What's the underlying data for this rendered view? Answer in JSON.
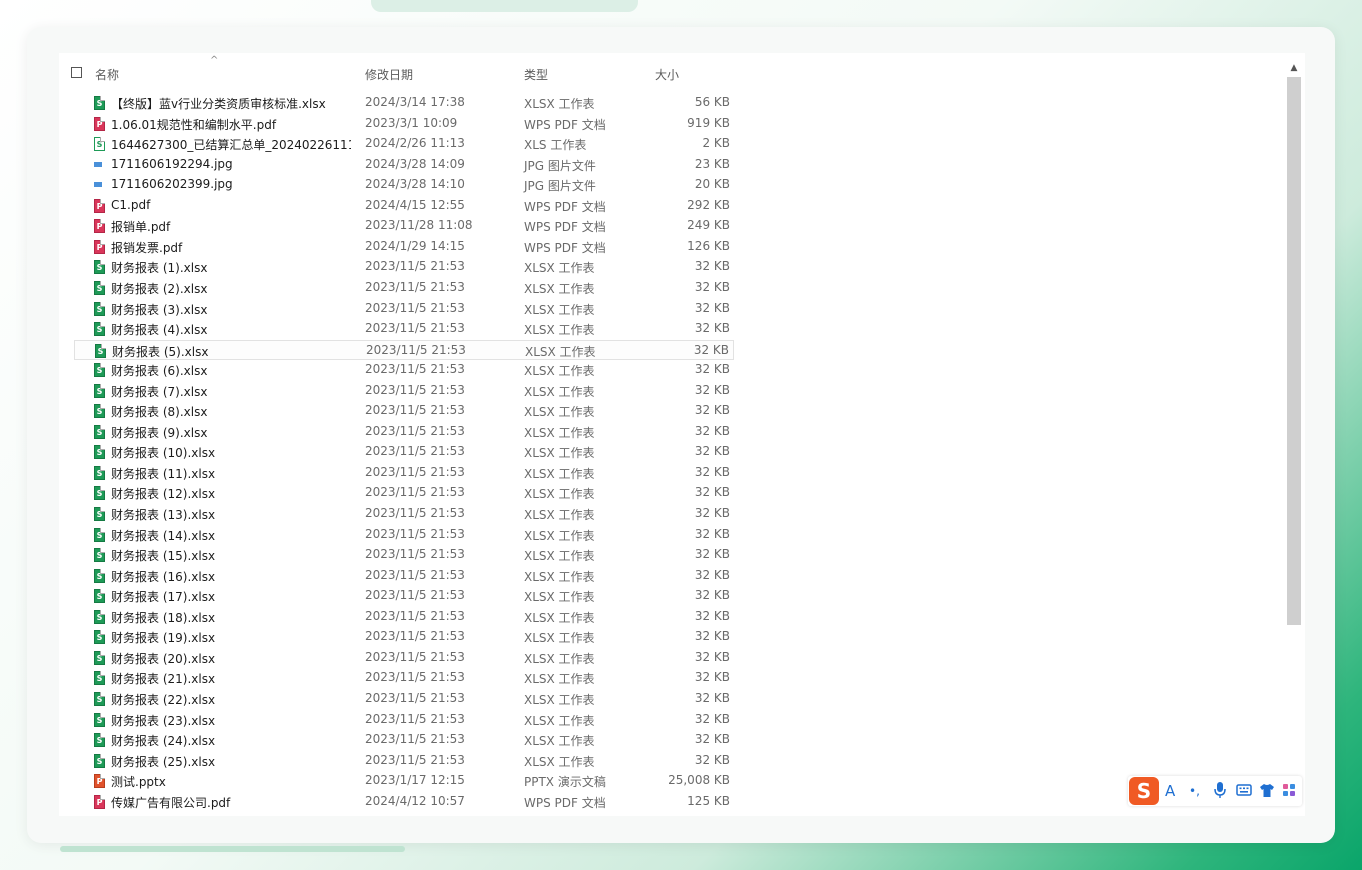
{
  "header": {
    "col_name": "名称",
    "col_date": "修改日期",
    "col_type": "类型",
    "col_size": "大小",
    "sort_glyph": "^"
  },
  "files": [
    {
      "name": "【终版】蓝v行业分类资质审核标准.xlsx",
      "date": "2024/3/14 17:38",
      "type": "XLSX 工作表",
      "size": "56 KB",
      "icon": "xlsx"
    },
    {
      "name": "1.06.01规范性和编制水平.pdf",
      "date": "2023/3/1 10:09",
      "type": "WPS PDF 文档",
      "size": "919 KB",
      "icon": "pdf"
    },
    {
      "name": "1644627300_已结算汇总单_20240226111...",
      "date": "2024/2/26 11:13",
      "type": "XLS 工作表",
      "size": "2 KB",
      "icon": "xls"
    },
    {
      "name": "1711606192294.jpg",
      "date": "2024/3/28 14:09",
      "type": "JPG 图片文件",
      "size": "23 KB",
      "icon": "jpg"
    },
    {
      "name": "1711606202399.jpg",
      "date": "2024/3/28 14:10",
      "type": "JPG 图片文件",
      "size": "20 KB",
      "icon": "jpg"
    },
    {
      "name": "C1.pdf",
      "date": "2024/4/15 12:55",
      "type": "WPS PDF 文档",
      "size": "292 KB",
      "icon": "pdf"
    },
    {
      "name": "报销单.pdf",
      "date": "2023/11/28 11:08",
      "type": "WPS PDF 文档",
      "size": "249 KB",
      "icon": "pdf"
    },
    {
      "name": "报销发票.pdf",
      "date": "2024/1/29 14:15",
      "type": "WPS PDF 文档",
      "size": "126 KB",
      "icon": "pdf"
    },
    {
      "name": "财务报表 (1).xlsx",
      "date": "2023/11/5 21:53",
      "type": "XLSX 工作表",
      "size": "32 KB",
      "icon": "xlsx"
    },
    {
      "name": "财务报表 (2).xlsx",
      "date": "2023/11/5 21:53",
      "type": "XLSX 工作表",
      "size": "32 KB",
      "icon": "xlsx"
    },
    {
      "name": "财务报表 (3).xlsx",
      "date": "2023/11/5 21:53",
      "type": "XLSX 工作表",
      "size": "32 KB",
      "icon": "xlsx"
    },
    {
      "name": "财务报表 (4).xlsx",
      "date": "2023/11/5 21:53",
      "type": "XLSX 工作表",
      "size": "32 KB",
      "icon": "xlsx"
    },
    {
      "name": "财务报表 (5).xlsx",
      "date": "2023/11/5 21:53",
      "type": "XLSX 工作表",
      "size": "32 KB",
      "icon": "xlsx"
    },
    {
      "name": "财务报表 (6).xlsx",
      "date": "2023/11/5 21:53",
      "type": "XLSX 工作表",
      "size": "32 KB",
      "icon": "xlsx"
    },
    {
      "name": "财务报表 (7).xlsx",
      "date": "2023/11/5 21:53",
      "type": "XLSX 工作表",
      "size": "32 KB",
      "icon": "xlsx"
    },
    {
      "name": "财务报表 (8).xlsx",
      "date": "2023/11/5 21:53",
      "type": "XLSX 工作表",
      "size": "32 KB",
      "icon": "xlsx"
    },
    {
      "name": "财务报表 (9).xlsx",
      "date": "2023/11/5 21:53",
      "type": "XLSX 工作表",
      "size": "32 KB",
      "icon": "xlsx"
    },
    {
      "name": "财务报表 (10).xlsx",
      "date": "2023/11/5 21:53",
      "type": "XLSX 工作表",
      "size": "32 KB",
      "icon": "xlsx"
    },
    {
      "name": "财务报表 (11).xlsx",
      "date": "2023/11/5 21:53",
      "type": "XLSX 工作表",
      "size": "32 KB",
      "icon": "xlsx"
    },
    {
      "name": "财务报表 (12).xlsx",
      "date": "2023/11/5 21:53",
      "type": "XLSX 工作表",
      "size": "32 KB",
      "icon": "xlsx"
    },
    {
      "name": "财务报表 (13).xlsx",
      "date": "2023/11/5 21:53",
      "type": "XLSX 工作表",
      "size": "32 KB",
      "icon": "xlsx"
    },
    {
      "name": "财务报表 (14).xlsx",
      "date": "2023/11/5 21:53",
      "type": "XLSX 工作表",
      "size": "32 KB",
      "icon": "xlsx"
    },
    {
      "name": "财务报表 (15).xlsx",
      "date": "2023/11/5 21:53",
      "type": "XLSX 工作表",
      "size": "32 KB",
      "icon": "xlsx"
    },
    {
      "name": "财务报表 (16).xlsx",
      "date": "2023/11/5 21:53",
      "type": "XLSX 工作表",
      "size": "32 KB",
      "icon": "xlsx"
    },
    {
      "name": "财务报表 (17).xlsx",
      "date": "2023/11/5 21:53",
      "type": "XLSX 工作表",
      "size": "32 KB",
      "icon": "xlsx"
    },
    {
      "name": "财务报表 (18).xlsx",
      "date": "2023/11/5 21:53",
      "type": "XLSX 工作表",
      "size": "32 KB",
      "icon": "xlsx"
    },
    {
      "name": "财务报表 (19).xlsx",
      "date": "2023/11/5 21:53",
      "type": "XLSX 工作表",
      "size": "32 KB",
      "icon": "xlsx"
    },
    {
      "name": "财务报表 (20).xlsx",
      "date": "2023/11/5 21:53",
      "type": "XLSX 工作表",
      "size": "32 KB",
      "icon": "xlsx"
    },
    {
      "name": "财务报表 (21).xlsx",
      "date": "2023/11/5 21:53",
      "type": "XLSX 工作表",
      "size": "32 KB",
      "icon": "xlsx"
    },
    {
      "name": "财务报表 (22).xlsx",
      "date": "2023/11/5 21:53",
      "type": "XLSX 工作表",
      "size": "32 KB",
      "icon": "xlsx"
    },
    {
      "name": "财务报表 (23).xlsx",
      "date": "2023/11/5 21:53",
      "type": "XLSX 工作表",
      "size": "32 KB",
      "icon": "xlsx"
    },
    {
      "name": "财务报表 (24).xlsx",
      "date": "2023/11/5 21:53",
      "type": "XLSX 工作表",
      "size": "32 KB",
      "icon": "xlsx"
    },
    {
      "name": "财务报表 (25).xlsx",
      "date": "2023/11/5 21:53",
      "type": "XLSX 工作表",
      "size": "32 KB",
      "icon": "xlsx"
    },
    {
      "name": "测试.pptx",
      "date": "2023/1/17 12:15",
      "type": "PPTX 演示文稿",
      "size": "25,008 KB",
      "icon": "pptx"
    },
    {
      "name": "传媒广告有限公司.pdf",
      "date": "2024/4/12 10:57",
      "type": "WPS PDF 文档",
      "size": "125 KB",
      "icon": "pdf"
    }
  ],
  "icon_glyphs": {
    "xlsx": "S",
    "xls": "S",
    "pdf": "P",
    "pptx": "P",
    "jpg": ""
  },
  "hover_row_index": 12,
  "ime": {
    "logo": "S",
    "char_mode": "A",
    "punct": "•,",
    "mic_icon": "microphone-icon",
    "keyboard_icon": "keyboard-icon",
    "skin_icon": "tshirt-icon",
    "toolbox_icon": "grid-apps-icon"
  },
  "colors": {
    "xlsx": "#1e9a57",
    "pdf": "#d9365a",
    "pptx": "#e0522c",
    "jpg": "#4a90d9",
    "ime_accent": "#1f6fd1",
    "ime_logo": "#f05a24"
  }
}
